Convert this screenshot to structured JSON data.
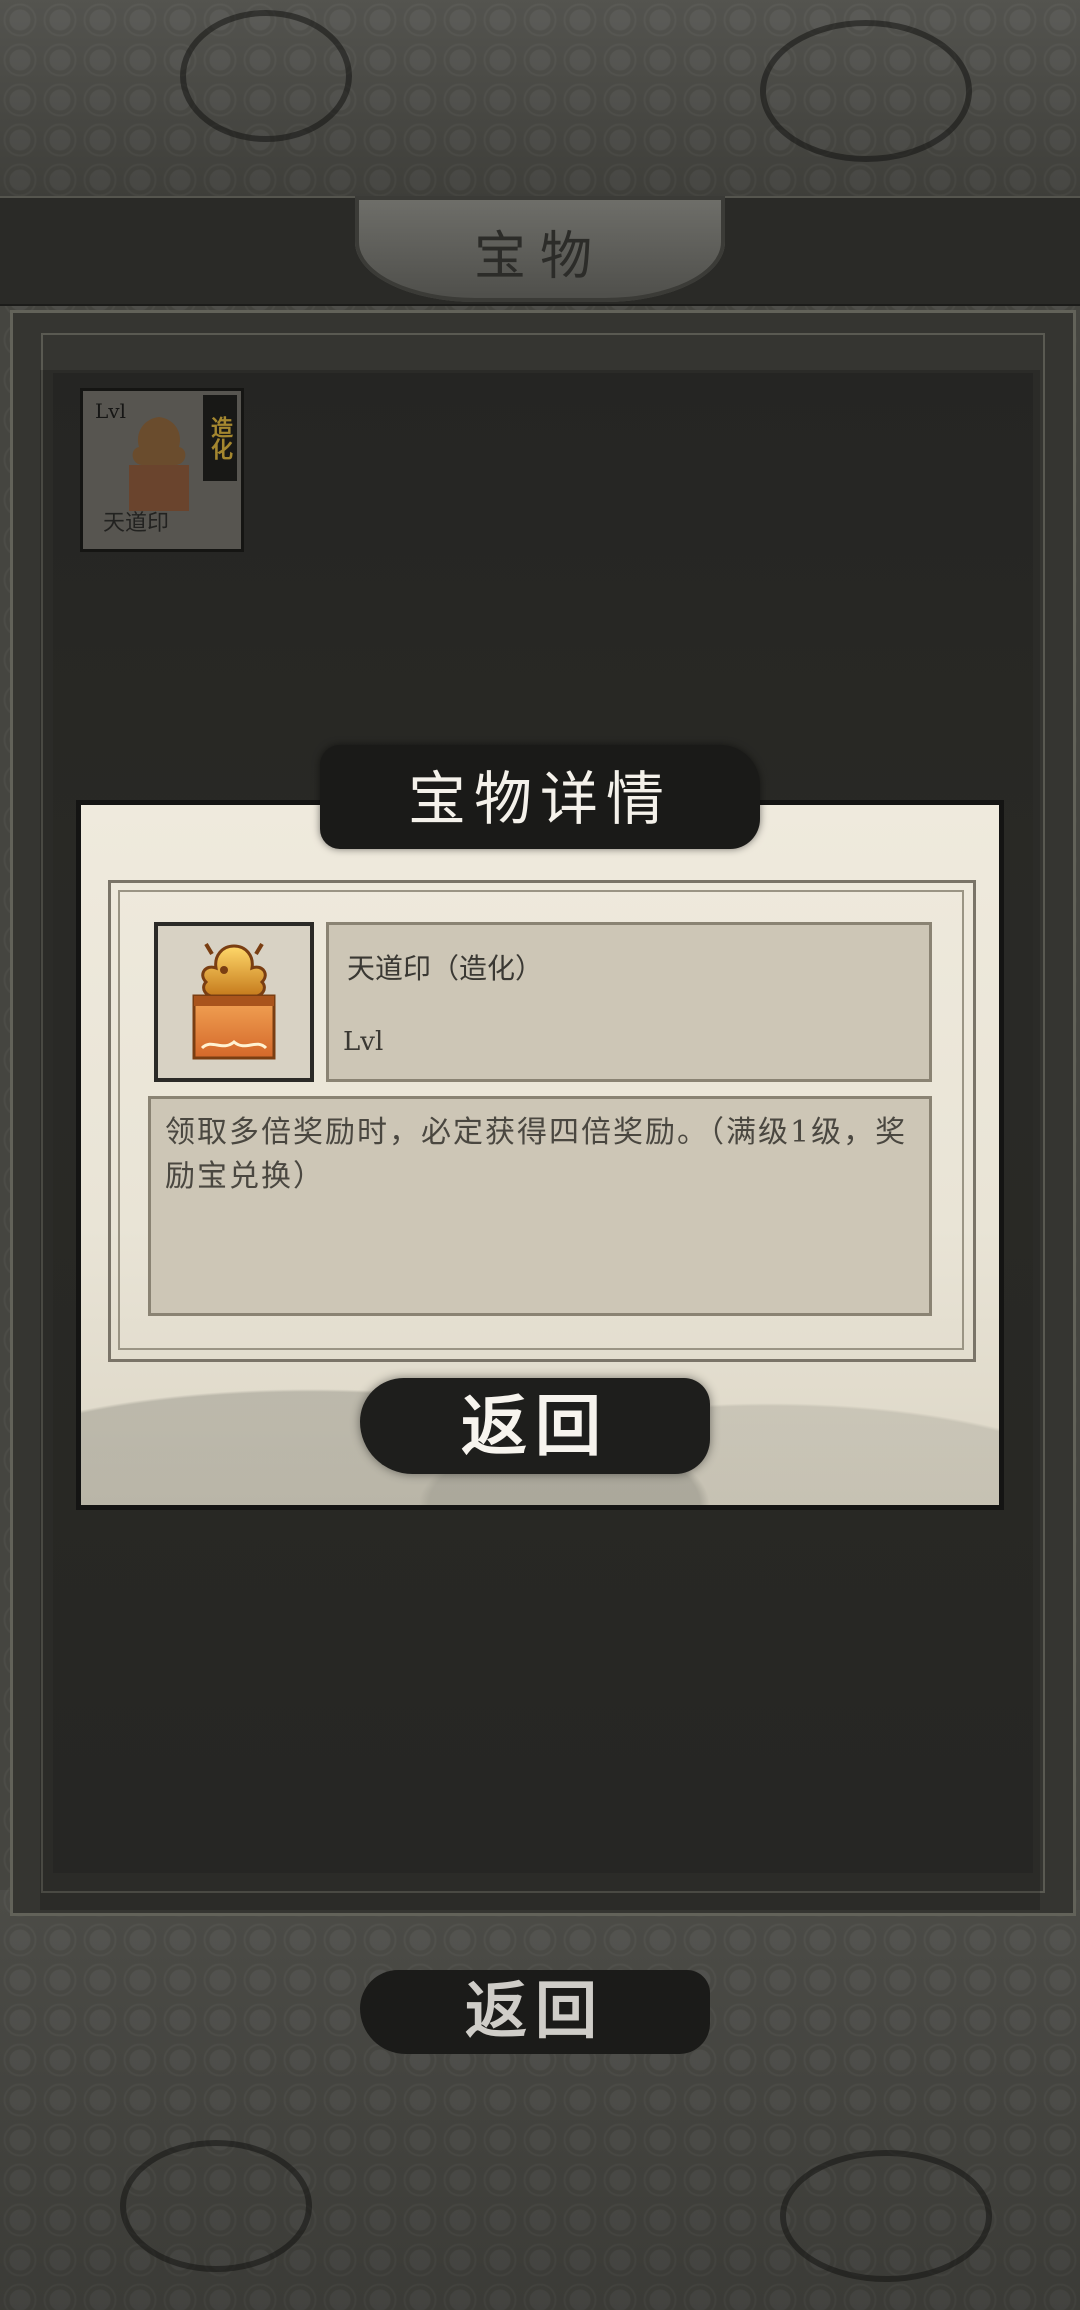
{
  "header": {
    "title": "宝物"
  },
  "treasure_slot": {
    "level": "Lvl",
    "badge": "造化",
    "name": "天道印"
  },
  "dialog": {
    "title": "宝物详情",
    "item_name": "天道印（造化）",
    "item_level": "Lvl",
    "description": "领取多倍奖励时，必定获得四倍奖励。（满级1级，奖励宝兑换）",
    "return_label": "返回"
  },
  "footer": {
    "return_label": "返回"
  },
  "icons": {
    "seal": "dragon-seal-icon"
  },
  "colors": {
    "badge_gold": "#c9a53a",
    "dialog_bg": "#efeadd"
  }
}
